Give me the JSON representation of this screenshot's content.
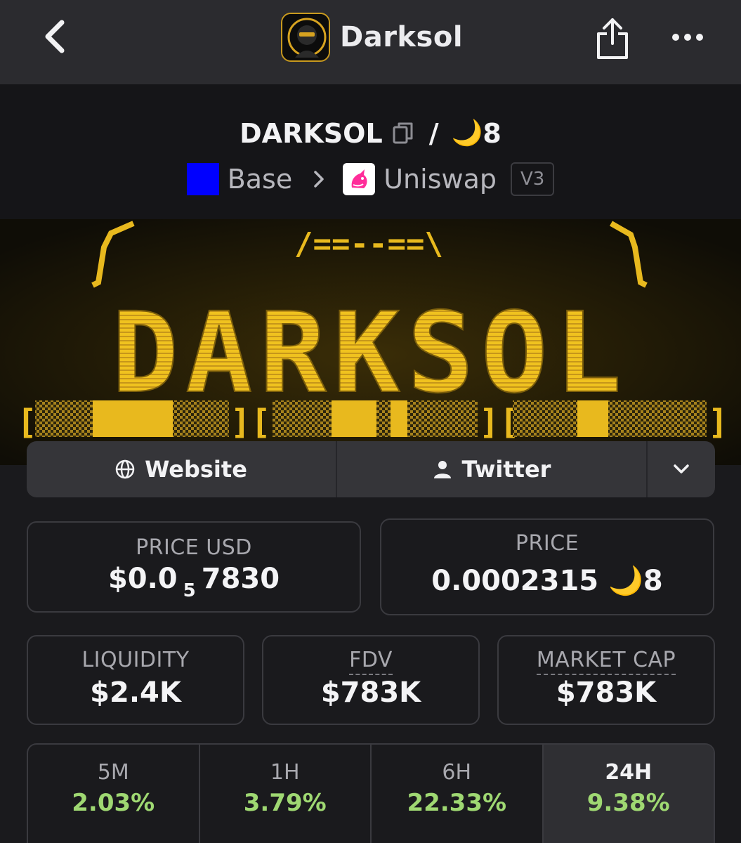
{
  "header": {
    "title": "Darksol",
    "icons": {
      "back": "back-chevron-icon",
      "share": "share-icon",
      "more": "more-dots-icon"
    }
  },
  "pair": {
    "base": "DARKSOL",
    "separator": "/",
    "quote_emoji": "🌙",
    "quote_text": "8",
    "chain": "Base",
    "chain_color": "#0000ff",
    "dex": "Uniswap",
    "version": "V3"
  },
  "banner": {
    "logo_text": "DARKSOL",
    "ascii": "/==--==\\"
  },
  "links": {
    "website_label": "Website",
    "twitter_label": "Twitter"
  },
  "stats": {
    "price_usd": {
      "label": "PRICE USD",
      "prefix": "$0.0",
      "sub": "5",
      "suffix": "7830"
    },
    "price": {
      "label": "PRICE",
      "value": "0.0002315",
      "emoji": "🌙",
      "suffix": "8"
    },
    "liquidity": {
      "label": "LIQUIDITY",
      "value": "$2.4K"
    },
    "fdv": {
      "label": "FDV",
      "value": "$783K"
    },
    "market_cap": {
      "label": "MARKET CAP",
      "value": "$783K"
    }
  },
  "timeframes": [
    {
      "label": "5M",
      "value": "2.03%"
    },
    {
      "label": "1H",
      "value": "3.79%"
    },
    {
      "label": "6H",
      "value": "22.33%"
    },
    {
      "label": "24H",
      "value": "9.38%",
      "active": true
    }
  ],
  "colors": {
    "positive": "#9fd872",
    "accent_gold": "#f2c22a"
  }
}
